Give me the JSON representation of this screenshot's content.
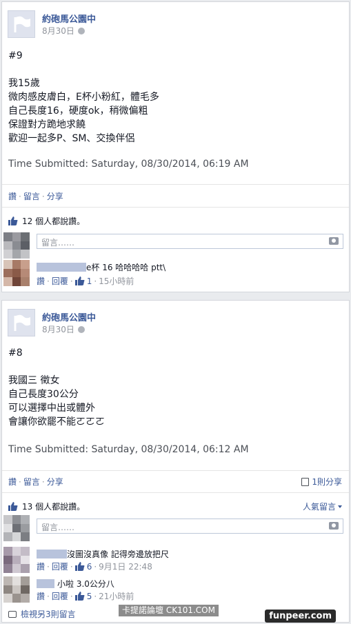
{
  "posts": [
    {
      "page_name": "約砲馬公園中",
      "date": "8月30日",
      "lines": [
        "#9",
        "",
        "我15歲",
        "微肉感皮膚白，E杯小粉紅，體毛多",
        "自己長度16，硬度ok，稍微偏粗",
        "保證對方跪地求饒",
        "歡迎一起多P、SM、交換伴侶"
      ],
      "time_submitted": "Time Submitted: Saturday, 08/30/2014, 06:19 AM",
      "actions": [
        "讚",
        "留言",
        "分享"
      ],
      "likes_text": "12 個人都說讚。",
      "comment_placeholder": "留言……",
      "comments": [
        {
          "text": "e杯 16 哈哈哈哈 ptt\\",
          "like_label": "讚",
          "reply_label": "回覆",
          "like_count": "1",
          "time": "15小時前"
        }
      ]
    },
    {
      "page_name": "約砲馬公園中",
      "date": "8月30日",
      "lines": [
        "#8",
        "",
        "我國三 徵女",
        "自己長度30公分",
        "可以選擇中出或體外",
        "會讓你欲罷不能ㄛㄛㄛ"
      ],
      "time_submitted": "Time Submitted: Saturday, 08/30/2014, 06:12 AM",
      "actions": [
        "讚",
        "留言",
        "分享"
      ],
      "shares_text": "1則分享",
      "likes_text": "13 個人都說讚。",
      "top_comments": "人氣留言",
      "comment_placeholder": "留言……",
      "comments": [
        {
          "text": "沒圖沒真像 記得旁邊放把尺",
          "like_label": "讚",
          "reply_label": "回覆",
          "like_count": "6",
          "time": "9月1日 22:48"
        },
        {
          "text": "小啦 3.0公分八",
          "like_label": "讚",
          "reply_label": "回覆",
          "like_count": "5",
          "time": "21小時前"
        }
      ],
      "more_comments": "檢視另3則留言"
    }
  ],
  "watermarks": {
    "forum": "卡提諾論壇 CK101.COM",
    "site": "funpeer.com"
  },
  "colors": {
    "link": "#3b5998",
    "muted": "#90949c",
    "bg": "#e9ebee"
  }
}
